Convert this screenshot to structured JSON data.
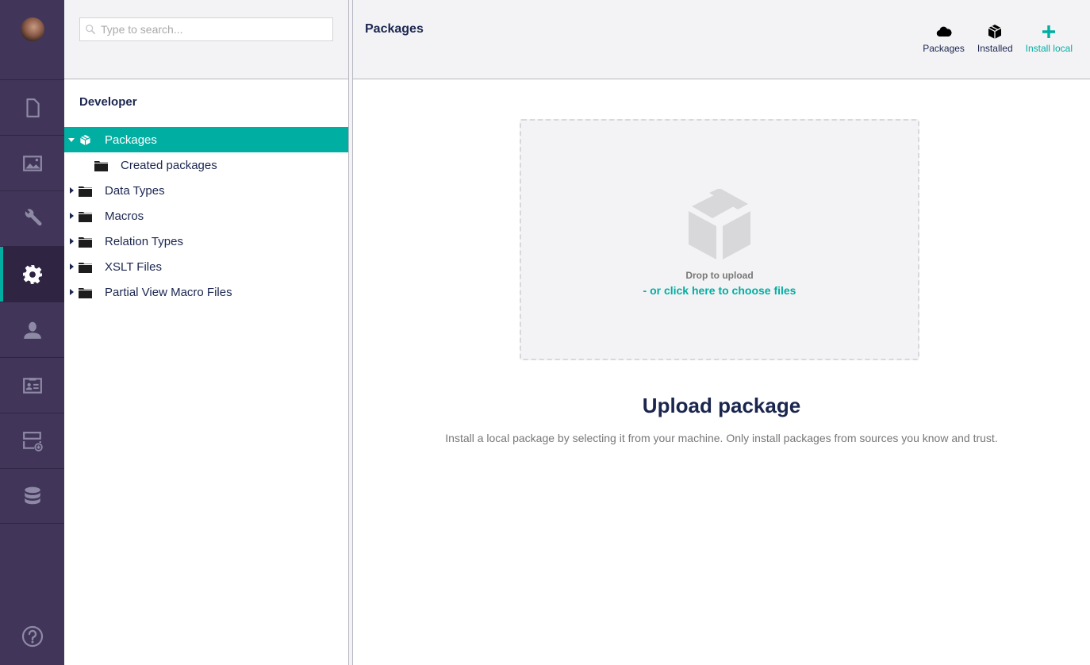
{
  "sections": {
    "avatar": "user-avatar",
    "items": [
      {
        "name": "content",
        "icon": "document-icon",
        "active": false
      },
      {
        "name": "media",
        "icon": "image-icon",
        "active": false
      },
      {
        "name": "settings",
        "icon": "wrench-icon",
        "active": false
      },
      {
        "name": "developer",
        "icon": "gear-icon",
        "active": true
      },
      {
        "name": "users",
        "icon": "user-icon",
        "active": false
      },
      {
        "name": "members",
        "icon": "id-card-icon",
        "active": false
      },
      {
        "name": "forms",
        "icon": "form-add-icon",
        "active": false
      },
      {
        "name": "database",
        "icon": "database-icon",
        "active": false
      }
    ],
    "help_icon": "help-icon"
  },
  "tree": {
    "search_placeholder": "Type to search...",
    "search_value": "",
    "root_label": "Developer",
    "items": [
      {
        "label": "Packages",
        "icon": "package-icon",
        "expanded": true,
        "selected": true
      },
      {
        "label": "Created packages",
        "icon": "folder-icon",
        "child": true
      },
      {
        "label": "Data Types",
        "icon": "folder-icon"
      },
      {
        "label": "Macros",
        "icon": "folder-icon"
      },
      {
        "label": "Relation Types",
        "icon": "folder-icon"
      },
      {
        "label": "XSLT Files",
        "icon": "folder-icon"
      },
      {
        "label": "Partial View Macro Files",
        "icon": "folder-icon"
      }
    ]
  },
  "main": {
    "title": "Packages",
    "sub_nav": [
      {
        "label": "Packages",
        "icon": "cloud-icon",
        "active": false
      },
      {
        "label": "Installed",
        "icon": "box-icon",
        "active": false
      },
      {
        "label": "Install local",
        "icon": "plus-icon",
        "active": true
      }
    ],
    "dropzone": {
      "drop_text": "Drop to upload",
      "choose_text": "- or click here to choose files"
    },
    "upload_title": "Upload package",
    "upload_description": "Install a local package by selecting it from your machine. Only install packages from sources you know and trust."
  },
  "colors": {
    "accent": "#00aea2",
    "sidebar": "#413659",
    "sidebar_active": "#2f2543",
    "header_bg": "#f3f3f5",
    "text": "#1b264f"
  }
}
